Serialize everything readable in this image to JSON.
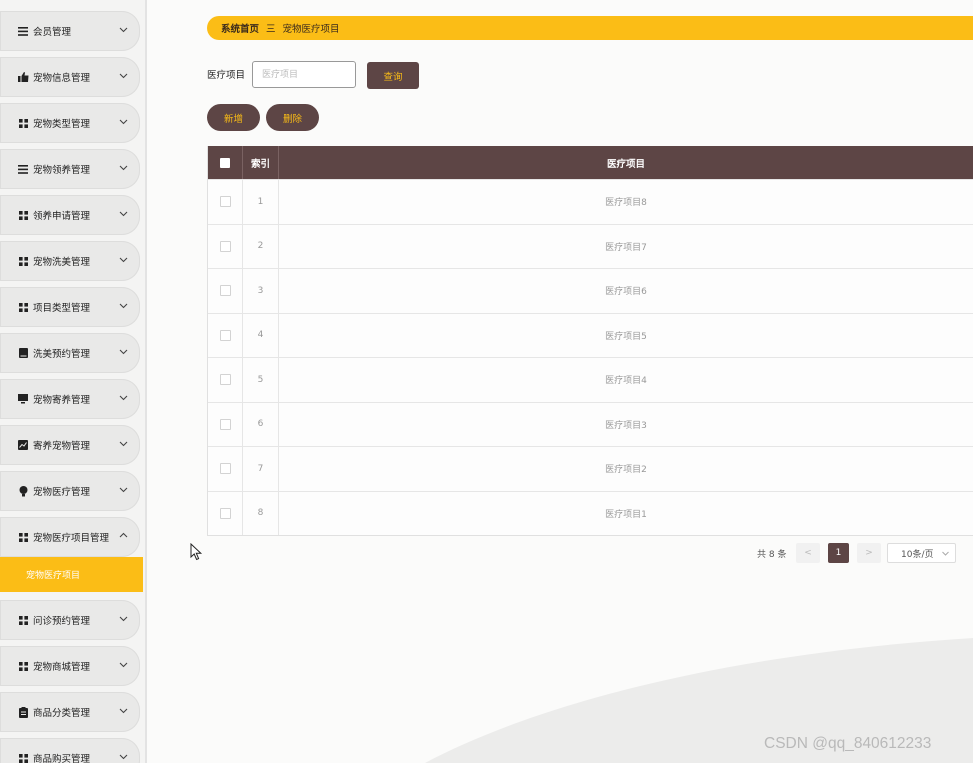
{
  "sidebar": {
    "items": [
      {
        "label": "会员管理",
        "icon": "list-icon"
      },
      {
        "label": "宠物信息管理",
        "icon": "thumb-icon"
      },
      {
        "label": "宠物类型管理",
        "icon": "grid-icon"
      },
      {
        "label": "宠物领养管理",
        "icon": "list-icon"
      },
      {
        "label": "领养申请管理",
        "icon": "grid-icon"
      },
      {
        "label": "宠物洗美管理",
        "icon": "grid-icon"
      },
      {
        "label": "项目类型管理",
        "icon": "grid-icon"
      },
      {
        "label": "洗美预约管理",
        "icon": "book-icon"
      },
      {
        "label": "宠物寄养管理",
        "icon": "monitor-icon"
      },
      {
        "label": "寄养宠物管理",
        "icon": "chart-icon"
      },
      {
        "label": "宠物医疗管理",
        "icon": "bulb-icon"
      },
      {
        "label": "宠物医疗项目管理",
        "icon": "grid-icon"
      },
      {
        "label": "问诊预约管理",
        "icon": "grid-icon"
      },
      {
        "label": "宠物商城管理",
        "icon": "grid-icon"
      },
      {
        "label": "商品分类管理",
        "icon": "clipboard-icon"
      },
      {
        "label": "商品购买管理",
        "icon": "grid-icon"
      }
    ],
    "active_submenu": "宠物医疗项目"
  },
  "breadcrumb": {
    "home": "系统首页",
    "separator": "三",
    "current": "宠物医疗项目"
  },
  "search": {
    "label": "医疗项目",
    "placeholder": "医疗项目",
    "value": "",
    "button": "查询"
  },
  "actions": {
    "add": "新增",
    "delete": "删除"
  },
  "table": {
    "headers": {
      "index": "索引",
      "name": "医疗项目"
    },
    "rows": [
      {
        "index": "1",
        "name": "医疗项目8"
      },
      {
        "index": "2",
        "name": "医疗项目7"
      },
      {
        "index": "3",
        "name": "医疗项目6"
      },
      {
        "index": "4",
        "name": "医疗项目5"
      },
      {
        "index": "5",
        "name": "医疗项目4"
      },
      {
        "index": "6",
        "name": "医疗项目3"
      },
      {
        "index": "7",
        "name": "医疗项目2"
      },
      {
        "index": "8",
        "name": "医疗项目1"
      }
    ]
  },
  "pagination": {
    "total": "共 8 条",
    "prev": "<",
    "current_page": "1",
    "next": ">",
    "page_size": "10条/页"
  },
  "watermark": "CSDN @qq_840612233",
  "colors": {
    "accent": "#fbbd16",
    "primary": "#5d4545"
  }
}
